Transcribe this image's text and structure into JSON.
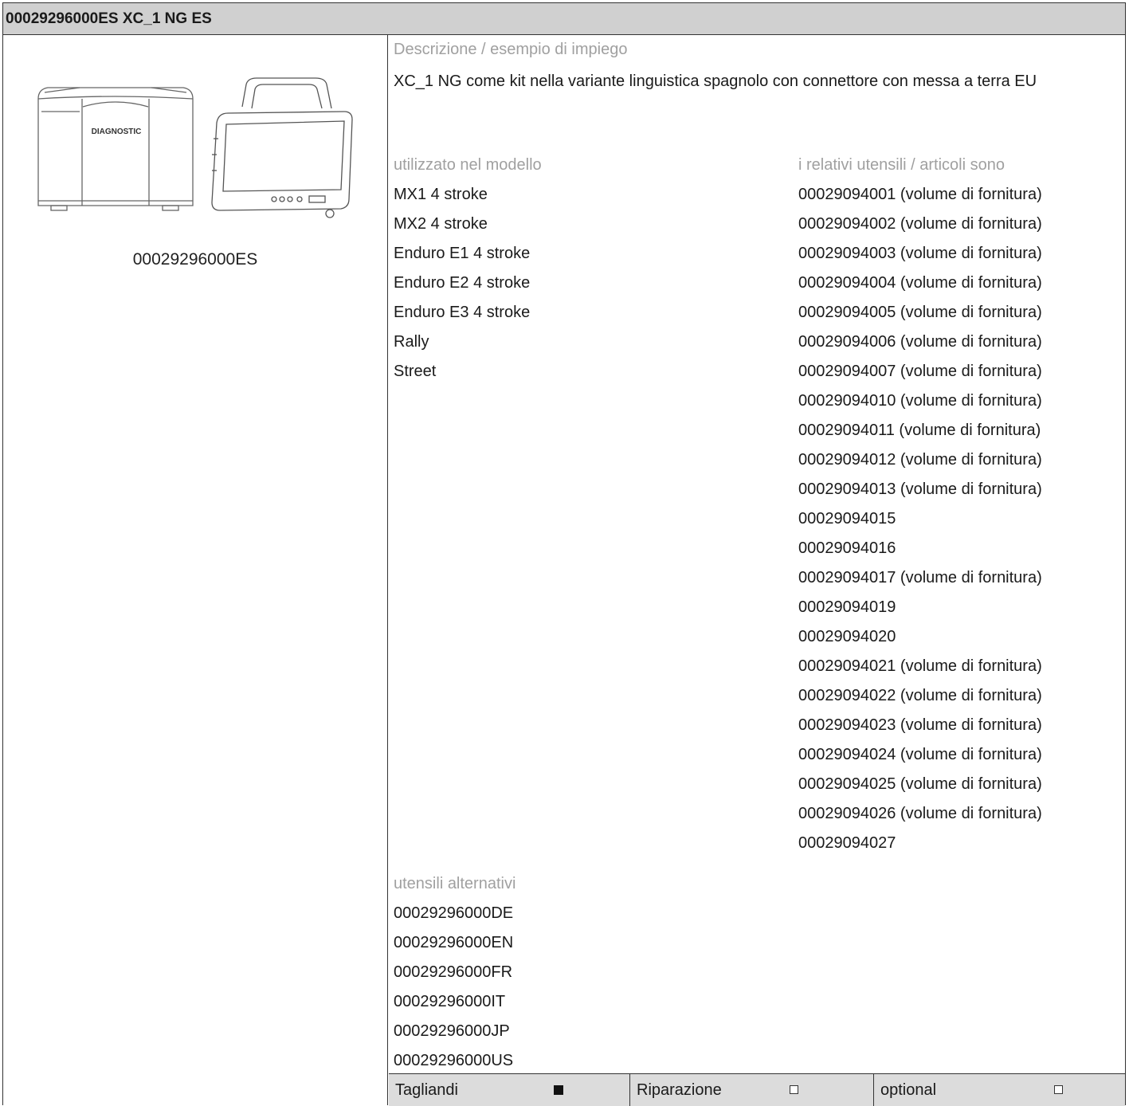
{
  "header": {
    "title": "00029296000ES XC_1 NG ES"
  },
  "image": {
    "caption": "00029296000ES",
    "case_label": "DIAGNOSTIC"
  },
  "description": {
    "label": "Descrizione / esempio di impiego",
    "text": "XC_1 NG come kit nella variante linguistica spagnolo con connettore con messa a terra EU"
  },
  "models": {
    "label": "utilizzato nel modello",
    "items": [
      "MX1 4 stroke",
      "MX2 4 stroke",
      "Enduro E1 4 stroke",
      "Enduro E2 4 stroke",
      "Enduro E3 4 stroke",
      "Rally",
      "Street"
    ]
  },
  "related": {
    "label": "i relativi utensili / articoli sono",
    "items": [
      "00029094001 (volume di fornitura)",
      "00029094002 (volume di fornitura)",
      "00029094003 (volume di fornitura)",
      "00029094004 (volume di fornitura)",
      "00029094005 (volume di fornitura)",
      "00029094006 (volume di fornitura)",
      "00029094007 (volume di fornitura)",
      "00029094010 (volume di fornitura)",
      "00029094011 (volume di fornitura)",
      "00029094012 (volume di fornitura)",
      "00029094013 (volume di fornitura)",
      "00029094015",
      "00029094016",
      "00029094017 (volume di fornitura)",
      "00029094019",
      "00029094020",
      "00029094021 (volume di fornitura)",
      "00029094022 (volume di fornitura)",
      "00029094023 (volume di fornitura)",
      "00029094024 (volume di fornitura)",
      "00029094025 (volume di fornitura)",
      "00029094026 (volume di fornitura)",
      "00029094027"
    ]
  },
  "alternatives": {
    "label": "utensili alternativi",
    "items": [
      "00029296000DE",
      "00029296000EN",
      "00029296000FR",
      "00029296000IT",
      "00029296000JP",
      "00029296000US"
    ]
  },
  "footer": [
    {
      "label": "Tagliandi",
      "checked": true
    },
    {
      "label": "Riparazione",
      "checked": false
    },
    {
      "label": "optional",
      "checked": false
    }
  ]
}
